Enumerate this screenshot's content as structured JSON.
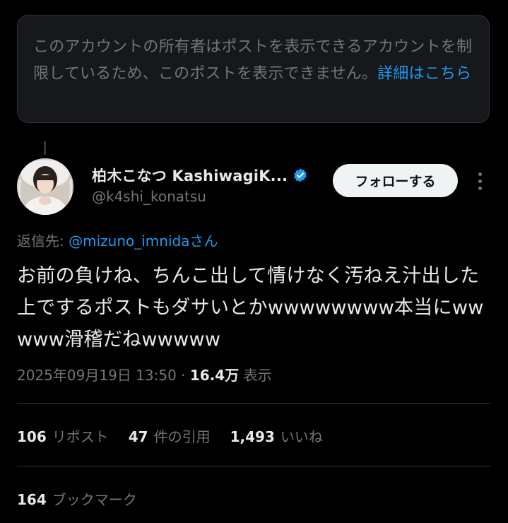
{
  "notice": {
    "text": "このアカウントの所有者はポストを表示できるアカウントを制限しているため、このポストを表示できません。",
    "link": "詳細はこちら"
  },
  "author": {
    "display_name": "柏木こなつ KashiwagiK...",
    "handle": "@k4shi_konatsu",
    "verified": true
  },
  "follow_button": {
    "label": "フォローする"
  },
  "more_button": {
    "icon": "more-vertical-icon"
  },
  "reply": {
    "prefix": "返信先: ",
    "mention": "@mizuno_imnida",
    "suffix": "さん"
  },
  "tweet": {
    "text": "お前の負けね、ちんこ出して情けなく汚ねえ汁出した上でするポストもダサいとかwwwwwwww本当にwwwww滑稽だねwwwww"
  },
  "meta": {
    "timestamp": "2025年09月19日 13:50",
    "separator": " · ",
    "views_count": "16.4万",
    "views_label": " 表示"
  },
  "stats": {
    "reposts_count": "106",
    "reposts_label": "リポスト",
    "quotes_count": "47",
    "quotes_label": "件の引用",
    "likes_count": "1,493",
    "likes_label": "いいね"
  },
  "bookmarks": {
    "count": "164",
    "label": "ブックマーク"
  },
  "colors": {
    "background": "#000000",
    "text_primary": "#e7e9ea",
    "text_secondary": "#71767b",
    "accent": "#1d9bf0",
    "border": "#2f3336"
  }
}
